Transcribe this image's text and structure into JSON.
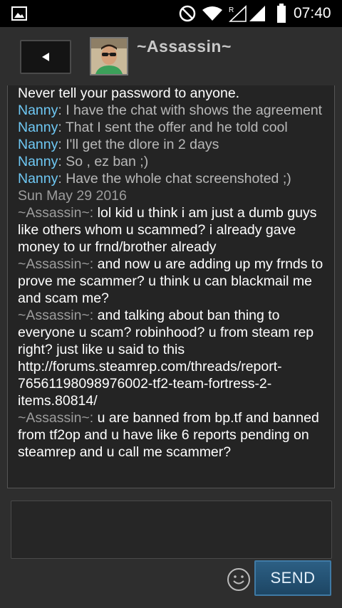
{
  "status_bar": {
    "time": "07:40",
    "icons": [
      "gallery-icon",
      "do-not-disturb-icon",
      "wifi-icon",
      "signal-roaming-icon",
      "signal-icon",
      "battery-icon"
    ],
    "roaming_badge": "R"
  },
  "header": {
    "title": "~Assassin~",
    "back_glyph": "◄",
    "avatar_icon": "profile-avatar"
  },
  "messages": [
    {
      "sender": "",
      "sender_style": "none",
      "text": "Never tell your password to anyone.",
      "text_style": "gray-white"
    },
    {
      "sender": "Nanny",
      "sender_style": "nanny",
      "text": " I have the chat with shows the agreement",
      "text_style": "gray"
    },
    {
      "sender": "Nanny",
      "sender_style": "nanny",
      "text": " That I sent the offer and he told cool",
      "text_style": "gray"
    },
    {
      "sender": "Nanny",
      "sender_style": "nanny",
      "text": " I'll get the dlore in 2 days",
      "text_style": "gray"
    },
    {
      "sender": "Nanny",
      "sender_style": "nanny",
      "text": " So , ez ban ;)",
      "text_style": "gray"
    },
    {
      "sender": "Nanny",
      "sender_style": "nanny",
      "text": " Have the whole chat screenshoted ;)",
      "text_style": "gray"
    },
    {
      "sender": "",
      "sender_style": "date",
      "text": "Sun May 29 2016",
      "text_style": "date"
    },
    {
      "sender": "~Assassin~:",
      "sender_style": "self",
      "text": " lol kid u think i am just a dumb guys like others whom u scammed? i already gave money to ur frnd/brother already",
      "text_style": "self"
    },
    {
      "sender": "~Assassin~:",
      "sender_style": "self",
      "text": " and now u are adding up my frnds to prove me scammer? u think u can blackmail me and scam me?",
      "text_style": "self"
    },
    {
      "sender": "~Assassin~:",
      "sender_style": "self",
      "text": " and talking about ban thing to everyone u scam? robinhood? u from steam rep right? just like u said to this http://forums.steamrep.com/threads/report-76561198098976002-tf2-team-fortress-2-items.80814/",
      "text_style": "self"
    },
    {
      "sender": "~Assassin~:",
      "sender_style": "self",
      "text": " u are banned from bp.tf and banned from tf2op and u have like 6 reports pending on steamrep and u call me scammer?",
      "text_style": "self"
    }
  ],
  "nanny_suffix": ":",
  "input": {
    "value": "",
    "placeholder": ""
  },
  "send_button": {
    "label": "SEND"
  },
  "emoji_button": {
    "icon": "smiley-icon"
  },
  "colors": {
    "nanny_name": "#6fc9f5",
    "self_name": "#9d9d9d",
    "accent_button": "#2c5f84",
    "background": "#2e2e2e"
  }
}
